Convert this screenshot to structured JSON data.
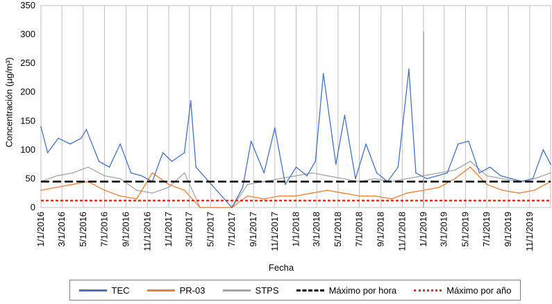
{
  "chart_data": {
    "type": "line",
    "xlabel": "Fecha",
    "ylabel": "Concentración (µg/m³)",
    "ylim": [
      0,
      350
    ],
    "yticks": [
      0,
      50,
      100,
      150,
      200,
      250,
      300,
      350
    ],
    "xlim": [
      "2016-01-01",
      "2019-12-31"
    ],
    "xticks": [
      "1/1/2016",
      "3/1/2016",
      "5/1/2016",
      "7/1/2016",
      "9/1/2016",
      "11/1/2016",
      "1/1/2017",
      "3/1/2017",
      "5/1/2017",
      "7/1/2017",
      "9/1/2017",
      "11/1/2017",
      "1/1/2018",
      "3/1/2018",
      "5/1/2018",
      "7/1/2018",
      "9/1/2018",
      "11/1/2018",
      "1/1/2019",
      "3/1/2019",
      "5/1/2019",
      "7/1/2019",
      "9/1/2019",
      "11/1/2019"
    ],
    "grid": "vertical",
    "legend_position": "bottom",
    "series": [
      {
        "name": "STPS",
        "color": "#a5a5a5",
        "x": [
          "2016-01-01",
          "2016-02-15",
          "2016-04-01",
          "2016-05-15",
          "2016-07-01",
          "2016-08-15",
          "2016-10-01",
          "2016-11-15",
          "2017-01-01",
          "2017-02-15",
          "2017-04-01",
          "2017-05-15",
          "2017-07-01",
          "2017-08-15",
          "2017-10-01",
          "2017-11-15",
          "2018-01-01",
          "2018-02-15",
          "2018-04-01",
          "2018-05-15",
          "2018-07-01",
          "2018-08-15",
          "2018-10-01",
          "2018-11-15",
          "2019-01-01",
          "2019-02-15",
          "2019-04-01",
          "2019-05-15",
          "2019-07-01",
          "2019-08-15",
          "2019-10-01",
          "2019-11-15",
          "2019-12-31"
        ],
        "values": [
          45,
          55,
          60,
          70,
          55,
          50,
          30,
          25,
          35,
          60,
          0,
          0,
          0,
          40,
          45,
          50,
          55,
          60,
          55,
          50,
          45,
          50,
          45,
          50,
          55,
          60,
          65,
          80,
          55,
          50,
          45,
          50,
          60
        ]
      },
      {
        "name": "PR-03",
        "color": "#ed7d31",
        "x": [
          "2016-01-01",
          "2016-02-15",
          "2016-04-01",
          "2016-05-15",
          "2016-07-01",
          "2016-08-15",
          "2016-10-01",
          "2016-11-15",
          "2017-01-01",
          "2017-02-15",
          "2017-04-01",
          "2017-05-15",
          "2017-07-01",
          "2017-08-15",
          "2017-10-01",
          "2017-11-15",
          "2018-01-01",
          "2018-02-15",
          "2018-04-01",
          "2018-05-15",
          "2018-07-01",
          "2018-08-15",
          "2018-10-01",
          "2018-11-15",
          "2019-01-01",
          "2019-02-15",
          "2019-04-01",
          "2019-05-15",
          "2019-07-01",
          "2019-08-15",
          "2019-10-01",
          "2019-11-15",
          "2019-12-31"
        ],
        "values": [
          30,
          35,
          40,
          45,
          30,
          20,
          15,
          60,
          40,
          30,
          0,
          0,
          0,
          20,
          15,
          20,
          20,
          25,
          30,
          25,
          20,
          20,
          15,
          25,
          30,
          35,
          50,
          70,
          40,
          30,
          25,
          30,
          45
        ]
      },
      {
        "name": "TEC",
        "color": "#4472c4",
        "x": [
          "2016-01-01",
          "2016-01-20",
          "2016-02-20",
          "2016-03-25",
          "2016-04-25",
          "2016-05-10",
          "2016-06-15",
          "2016-07-15",
          "2016-08-15",
          "2016-09-15",
          "2016-10-15",
          "2016-11-15",
          "2016-12-15",
          "2017-01-10",
          "2017-02-15",
          "2017-03-05",
          "2017-03-20",
          "2017-07-01",
          "2017-08-01",
          "2017-08-25",
          "2017-10-01",
          "2017-11-01",
          "2017-12-01",
          "2018-01-01",
          "2018-02-01",
          "2018-02-25",
          "2018-03-20",
          "2018-04-25",
          "2018-05-20",
          "2018-06-20",
          "2018-07-20",
          "2018-08-20",
          "2018-09-20",
          "2018-10-20",
          "2018-11-20",
          "2018-12-10",
          "2019-01-10",
          "2019-02-10",
          "2019-03-10",
          "2019-04-10",
          "2019-05-10",
          "2019-06-10",
          "2019-07-10",
          "2019-08-10",
          "2019-09-10",
          "2019-10-10",
          "2019-11-10",
          "2019-12-10",
          "2019-12-31"
        ],
        "values": [
          140,
          95,
          120,
          110,
          120,
          135,
          80,
          70,
          110,
          60,
          55,
          45,
          95,
          80,
          95,
          185,
          70,
          0,
          35,
          115,
          60,
          138,
          40,
          70,
          55,
          80,
          232,
          75,
          160,
          50,
          110,
          60,
          45,
          70,
          240,
          60,
          50,
          55,
          60,
          110,
          115,
          60,
          70,
          55,
          50,
          45,
          50,
          100,
          75
        ]
      },
      {
        "name": "Máximo por hora",
        "color": "#000000",
        "style": "dashed",
        "x": [
          "2016-01-01",
          "2019-12-31"
        ],
        "values": [
          45,
          45
        ]
      },
      {
        "name": "Máximo por año",
        "color": "#e8291d",
        "style": "dotted",
        "x": [
          "2016-01-01",
          "2019-12-31"
        ],
        "values": [
          12,
          12
        ]
      }
    ],
    "annotations": [
      {
        "series": "STPS",
        "x": "2019-01-01",
        "value": 305
      }
    ]
  },
  "legend": [
    {
      "label": "TEC",
      "color": "#4472c4",
      "style": "solid"
    },
    {
      "label": "PR-03",
      "color": "#ed7d31",
      "style": "solid"
    },
    {
      "label": "STPS",
      "color": "#a5a5a5",
      "style": "solid"
    },
    {
      "label": "Máximo por hora",
      "color": "#000000",
      "style": "dashed"
    },
    {
      "label": "Máximo por año",
      "color": "#e8291d",
      "style": "dotted"
    }
  ]
}
